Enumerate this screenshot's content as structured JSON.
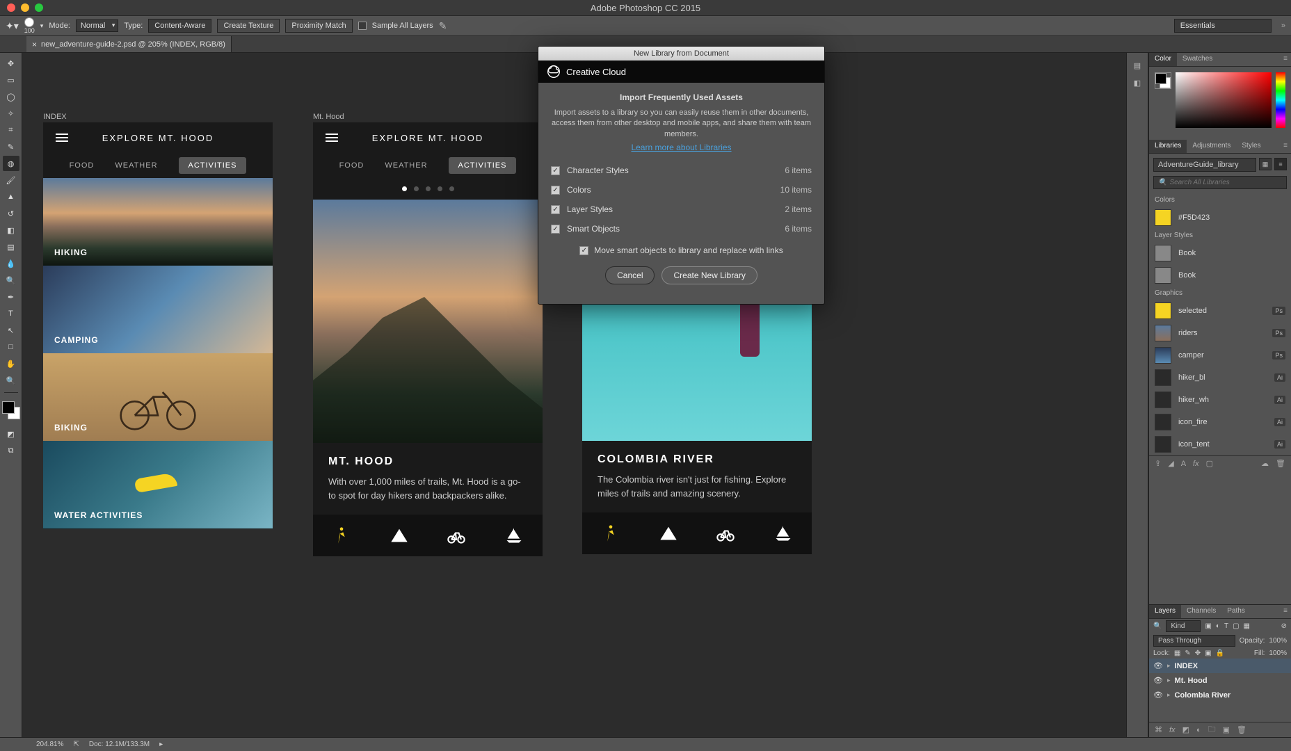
{
  "titlebar": {
    "title": "Adobe Photoshop CC 2015"
  },
  "optbar": {
    "brush_size": "100",
    "mode_label": "Mode:",
    "mode_value": "Normal",
    "type_label": "Type:",
    "btn1": "Content-Aware",
    "btn2": "Create Texture",
    "btn3": "Proximity Match",
    "sample_all": "Sample All Layers",
    "workspace": "Essentials"
  },
  "doctab": {
    "name": "new_adventure-guide-2.psd @ 205% (INDEX, RGB/8)"
  },
  "artboards": {
    "a1": {
      "label": "INDEX",
      "title": "EXPLORE MT. HOOD",
      "tabs": [
        "FOOD",
        "WEATHER",
        "ACTIVITIES"
      ],
      "tiles": [
        "HIKING",
        "CAMPING",
        "BIKING",
        "WATER ACTIVITIES"
      ]
    },
    "a2": {
      "label": "Mt. Hood",
      "title": "EXPLORE MT. HOOD",
      "tabs": [
        "FOOD",
        "WEATHER",
        "ACTIVITIES"
      ],
      "heading": "MT. HOOD",
      "body": "With over 1,000 miles of trails, Mt. Hood is a go-to spot for day hikers and backpackers alike."
    },
    "a3": {
      "heading": "COLOMBIA RIVER",
      "body": "The Colombia river isn't just for fishing. Explore miles of trails and amazing scenery."
    }
  },
  "dialog": {
    "title": "New Library from Document",
    "cc": "Creative Cloud",
    "heading": "Import Frequently Used Assets",
    "desc": "Import assets to a library so you can easily reuse them in other documents, access them from other desktop and mobile apps, and share them with team members.",
    "link": "Learn more about Libraries",
    "rows": [
      {
        "label": "Character Styles",
        "count": "6 items"
      },
      {
        "label": "Colors",
        "count": "10 items"
      },
      {
        "label": "Layer Styles",
        "count": "2 items"
      },
      {
        "label": "Smart Objects",
        "count": "6 items"
      }
    ],
    "move": "Move smart objects to library and replace with links",
    "cancel": "Cancel",
    "create": "Create New Library"
  },
  "panels": {
    "color_tabs": [
      "Color",
      "Swatches"
    ],
    "lib_tabs": [
      "Libraries",
      "Adjustments",
      "Styles"
    ],
    "lib_select": "AdventureGuide_library",
    "search_placeholder": "Search All Libraries",
    "sections": {
      "colors_h": "Colors",
      "colors": [
        {
          "hex": "#F5D423",
          "name": "#F5D423"
        }
      ],
      "layerstyles_h": "Layer Styles",
      "layerstyles": [
        "Book",
        "Book"
      ],
      "graphics_h": "Graphics",
      "graphics": [
        {
          "name": "selected",
          "badge": "Ps",
          "sw": "#f5d423"
        },
        {
          "name": "riders",
          "badge": "Ps",
          "sw": "linear-gradient(#5b7a9c,#8b6f5c)"
        },
        {
          "name": "camper",
          "badge": "Ps",
          "sw": "linear-gradient(#2b3c5a,#5a8bb3)"
        },
        {
          "name": "hiker_bl",
          "badge": "Ai",
          "sw": "#2a2a2a"
        },
        {
          "name": "hiker_wh",
          "badge": "Ai",
          "sw": "#2a2a2a"
        },
        {
          "name": "icon_fire",
          "badge": "Ai",
          "sw": "#2a2a2a"
        },
        {
          "name": "icon_tent",
          "badge": "Ai",
          "sw": "#2a2a2a"
        }
      ]
    },
    "layers_tabs": [
      "Layers",
      "Channels",
      "Paths"
    ],
    "layers_kind": "Kind",
    "layers_blend": "Pass Through",
    "layers_opacity_l": "Opacity:",
    "layers_opacity": "100%",
    "layers_lock_l": "Lock:",
    "layers_fill_l": "Fill:",
    "layers_fill": "100%",
    "layers": [
      {
        "name": "INDEX",
        "sel": true
      },
      {
        "name": "Mt. Hood",
        "sel": false
      },
      {
        "name": "Colombia River",
        "sel": false
      }
    ]
  },
  "status": {
    "zoom": "204.81%",
    "doc": "Doc: 12.1M/133.3M"
  }
}
